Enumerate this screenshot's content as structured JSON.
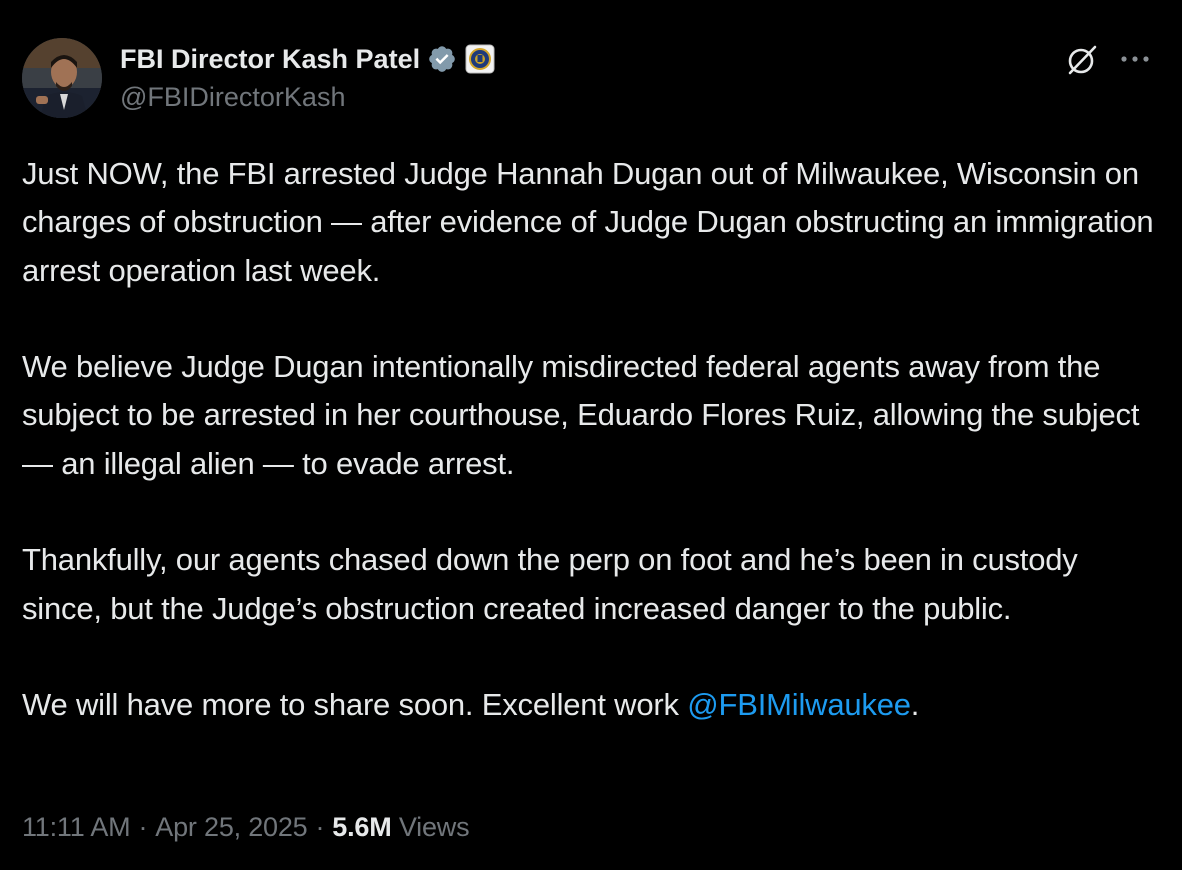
{
  "author": {
    "display_name": "FBI Director Kash Patel",
    "handle": "@FBIDirectorKash",
    "verified_badge": "verified-check-icon",
    "affiliation_badge": "fbi-seal-icon"
  },
  "tweet": {
    "paragraphs": [
      "Just NOW, the FBI arrested Judge Hannah Dugan out of Milwaukee, Wisconsin on charges of obstruction — after evidence of Judge Dugan obstructing an immigration arrest operation last week.",
      "We believe Judge Dugan intentionally misdirected federal agents away from the subject to be arrested in her courthouse, Eduardo Flores Ruiz, allowing the subject — an illegal alien — to evade arrest.",
      "Thankfully, our agents chased down the perp on foot and he’s been in custody since, but the Judge’s obstruction created increased danger to the public."
    ],
    "last_paragraph_prefix": "We will have more to share soon. Excellent work ",
    "mention": "@FBIMilwaukee",
    "last_paragraph_suffix": "."
  },
  "meta": {
    "time": "11:11 AM",
    "separator": "·",
    "date": "Apr 25, 2025",
    "views_count": "5.6M",
    "views_label": "Views"
  },
  "icons": {
    "grok": "grok-icon",
    "more": "more-options-icon"
  },
  "colors": {
    "background": "#000000",
    "text_primary": "#e7e9ea",
    "text_secondary": "#71767b",
    "link": "#1d9bf0",
    "verified": "#829aab"
  }
}
